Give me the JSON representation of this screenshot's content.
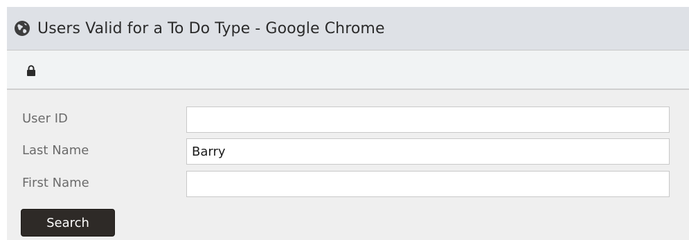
{
  "window": {
    "title": "Users Valid for a To Do Type - Google Chrome"
  },
  "addressbar": {
    "icon": "lock-icon"
  },
  "form": {
    "fields": [
      {
        "label": "User ID",
        "value": ""
      },
      {
        "label": "Last Name",
        "value": "Barry"
      },
      {
        "label": "First Name",
        "value": ""
      }
    ],
    "search_label": "Search"
  },
  "colors": {
    "titlebar_bg": "#dee1e6",
    "form_bg": "#efefef",
    "button_bg": "#2e2a27"
  }
}
